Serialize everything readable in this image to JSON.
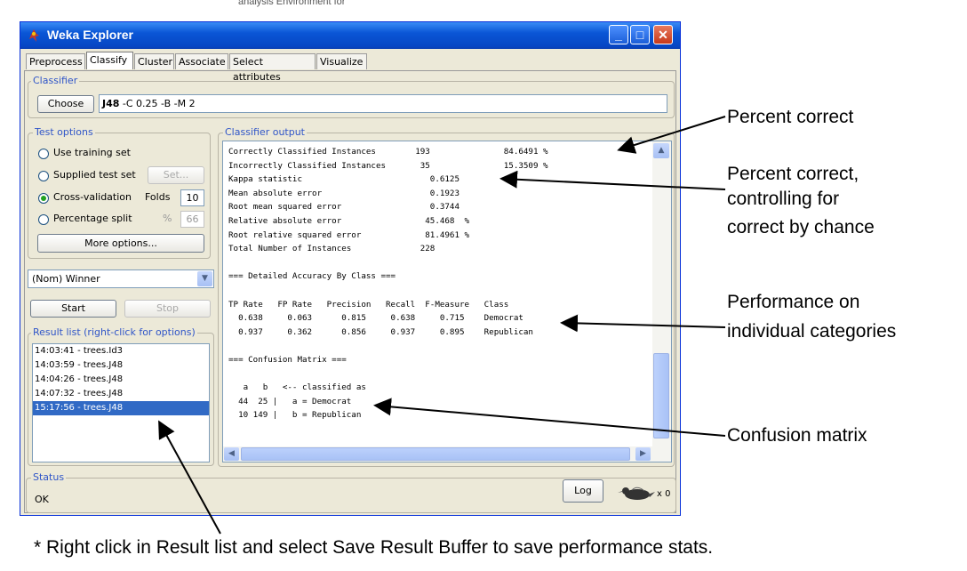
{
  "window": {
    "title": "Weka Explorer",
    "controls": {
      "minimize": "_",
      "maximize": "□",
      "close": "✕"
    },
    "background_title": "analysis Environment for"
  },
  "tabs": [
    "Preprocess",
    "Classify",
    "Cluster",
    "Associate",
    "Select attributes",
    "Visualize"
  ],
  "active_tab": "Classify",
  "classifier": {
    "group_label": "Classifier",
    "choose_label": "Choose",
    "name": "J48",
    "options": "-C 0.25 -B -M 2"
  },
  "test_options": {
    "group_label": "Test options",
    "use_training": "Use training set",
    "supplied_test": "Supplied test set",
    "set_button": "Set...",
    "cross_validation": "Cross-validation",
    "folds_label": "Folds",
    "folds_value": "10",
    "percentage_split": "Percentage split",
    "percent_symbol": "%",
    "percent_value": "66",
    "more_options": "More options...",
    "selected": "Cross-validation"
  },
  "class_attribute": "(Nom) Winner",
  "start_label": "Start",
  "stop_label": "Stop",
  "result_list": {
    "label": "Result list (right-click for options)",
    "items": [
      "14:03:41 - trees.Id3",
      "14:03:59 - trees.J48",
      "14:04:26 - trees.J48",
      "14:07:32 - trees.J48",
      "15:17:56 - trees.J48"
    ],
    "selected_index": 4
  },
  "output": {
    "label": "Classifier output",
    "lines": [
      "Correctly Classified Instances        193               84.6491 %",
      "Incorrectly Classified Instances       35               15.3509 %",
      "Kappa statistic                          0.6125",
      "Mean absolute error                      0.1923",
      "Root mean squared error                  0.3744",
      "Relative absolute error                 45.468  %",
      "Root relative squared error             81.4961 %",
      "Total Number of Instances              228",
      "",
      "=== Detailed Accuracy By Class ===",
      "",
      "TP Rate   FP Rate   Precision   Recall  F-Measure   Class",
      "  0.638     0.063      0.815     0.638     0.715    Democrat",
      "  0.937     0.362      0.856     0.937     0.895    Republican",
      "",
      "=== Confusion Matrix ===",
      "",
      "   a   b   <-- classified as",
      "  44  25 |   a = Democrat",
      "  10 149 |   b = Republican"
    ]
  },
  "status": {
    "label": "Status",
    "value": "OK",
    "log_label": "Log",
    "count": "x 0"
  },
  "annotations": {
    "percent_correct": "Percent correct",
    "kappa_line1": "Percent correct,",
    "kappa_line2": "controlling for",
    "kappa_line3": "correct by chance",
    "perf_line1": "Performance on",
    "perf_line2": "individual categories",
    "confusion": "Confusion matrix",
    "footnote": "* Right click in Result list and select Save Result Buffer to save performance stats."
  }
}
